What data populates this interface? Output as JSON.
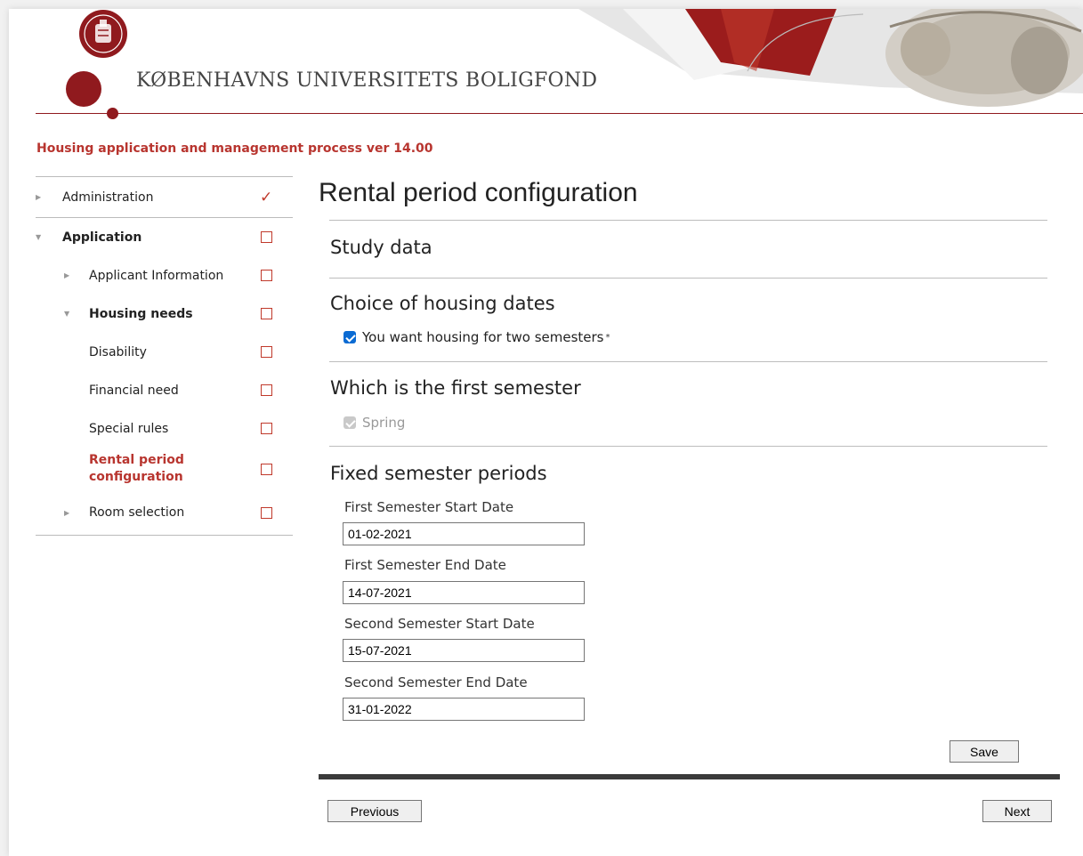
{
  "header": {
    "org_name": "KØBENHAVNS UNIVERSITETS BOLIGFOND",
    "logo_icon": "university-seal-icon",
    "brand_color": "#901a1e",
    "accent_color": "#b8352f"
  },
  "process_title": "Housing application and management process ver 14.00",
  "sidebar": {
    "items": [
      {
        "label": "Administration",
        "status": "done"
      },
      {
        "label": "Application",
        "status": "pending"
      },
      {
        "label": "Applicant Information",
        "status": "pending"
      },
      {
        "label": "Housing needs",
        "status": "pending"
      },
      {
        "label": "Disability",
        "status": "pending"
      },
      {
        "label": "Financial need",
        "status": "pending"
      },
      {
        "label": "Special rules",
        "status": "pending"
      },
      {
        "label": "Rental period configuration",
        "status": "pending"
      },
      {
        "label": "Room selection",
        "status": "pending"
      }
    ],
    "done_mark": "✓"
  },
  "main": {
    "title": "Rental period configuration",
    "sections": {
      "study_data": "Study data",
      "housing_dates": {
        "title": "Choice of housing dates",
        "two_semesters_label": "You want housing for two semesters",
        "two_semesters_checked": true,
        "required_marker": "*"
      },
      "first_semester": {
        "title": "Which is the first semester",
        "spring_label": "Spring",
        "spring_checked": true
      },
      "fixed_periods": {
        "title": "Fixed semester periods",
        "fields": [
          {
            "label": "First Semester Start Date",
            "value": "01-02-2021"
          },
          {
            "label": "First Semester End Date",
            "value": "14-07-2021"
          },
          {
            "label": "Second Semester Start Date",
            "value": "15-07-2021"
          },
          {
            "label": "Second Semester End Date",
            "value": "31-01-2022"
          }
        ]
      }
    },
    "buttons": {
      "save": "Save",
      "previous": "Previous",
      "next": "Next"
    }
  }
}
